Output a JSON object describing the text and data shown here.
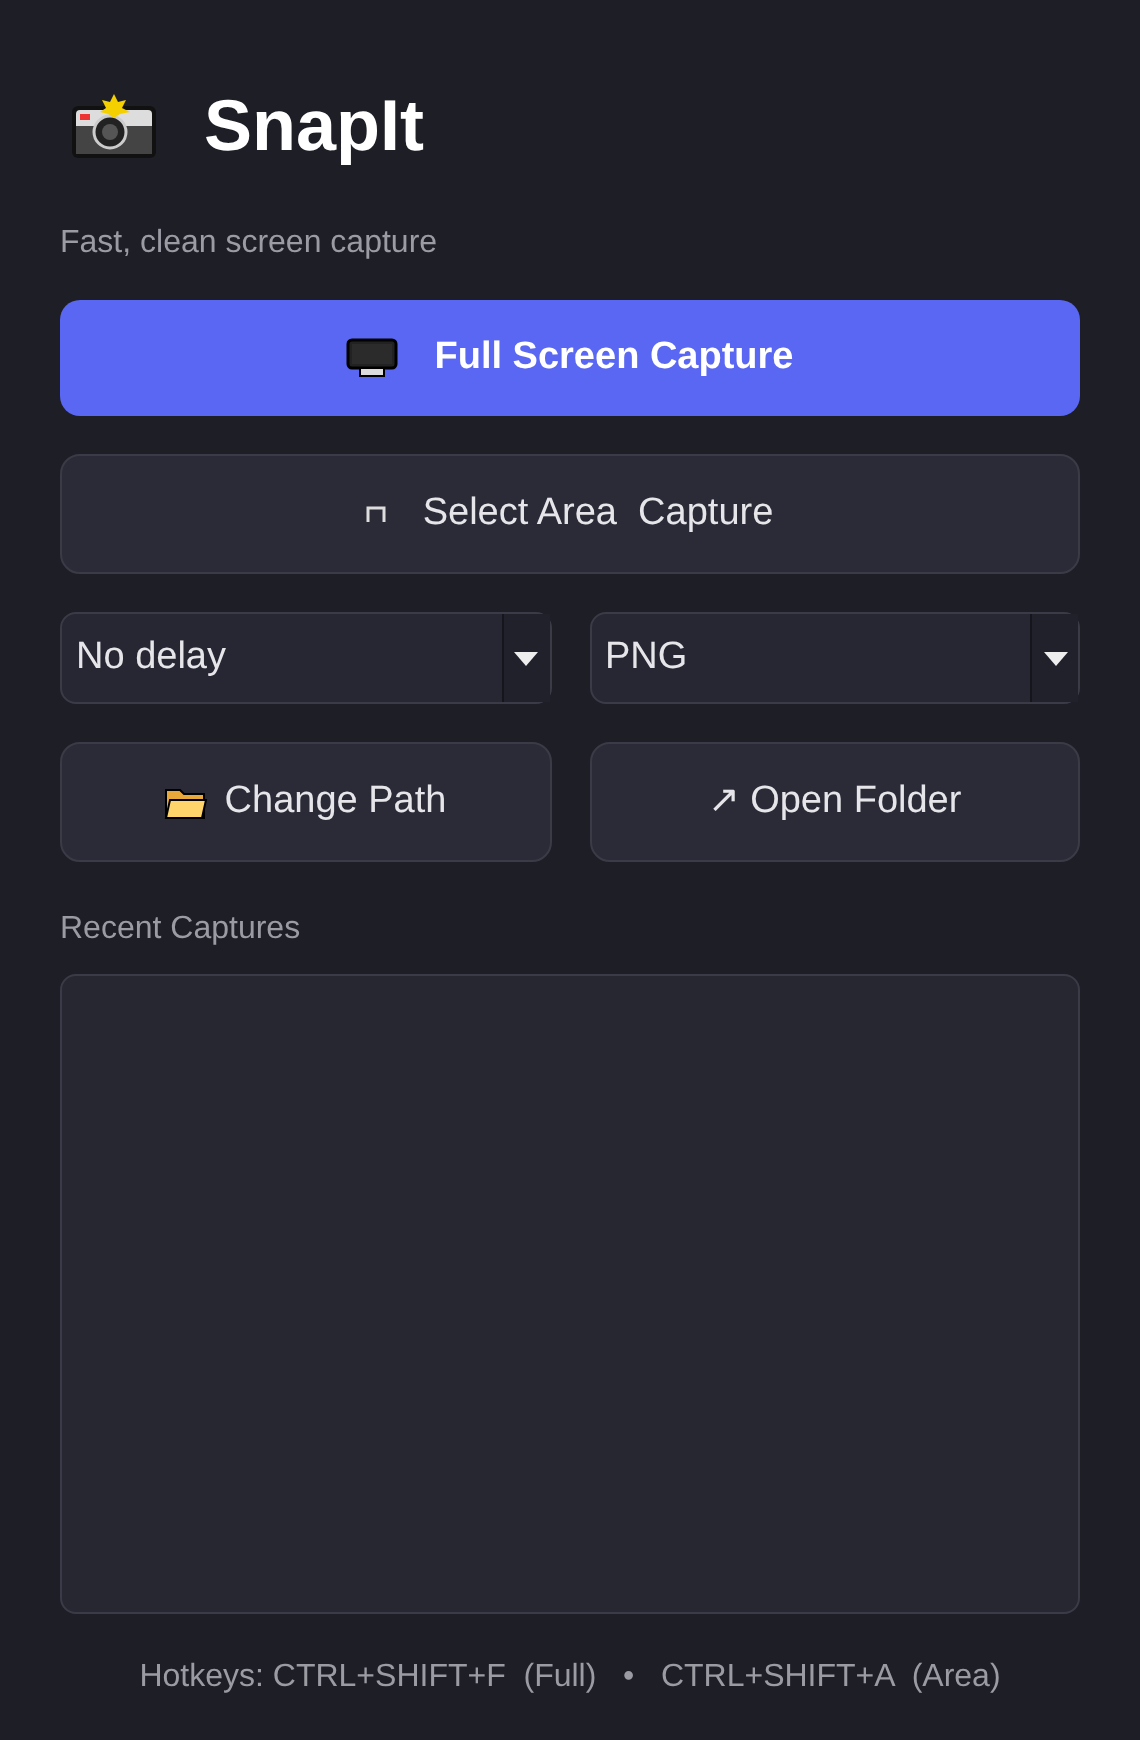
{
  "app": {
    "title": "SnapIt",
    "subtitle": "Fast, clean screen capture"
  },
  "primary_buttons": [
    {
      "kind": "full",
      "label": "Full Screen Capture"
    },
    {
      "kind": "area",
      "label": "Select Area  Capture"
    }
  ],
  "selects": [
    {
      "value": "No delay"
    },
    {
      "value": "PNG"
    }
  ],
  "actions": [
    {
      "kind": "folder",
      "label": "Change Path"
    },
    {
      "kind": "open",
      "label": "↗ Open Folder"
    }
  ],
  "recent": {
    "label": "Recent Captures"
  },
  "footer": "Hotkeys: CTRL+SHIFT+F  (Full)   •   CTRL+SHIFT+A  (Area)"
}
